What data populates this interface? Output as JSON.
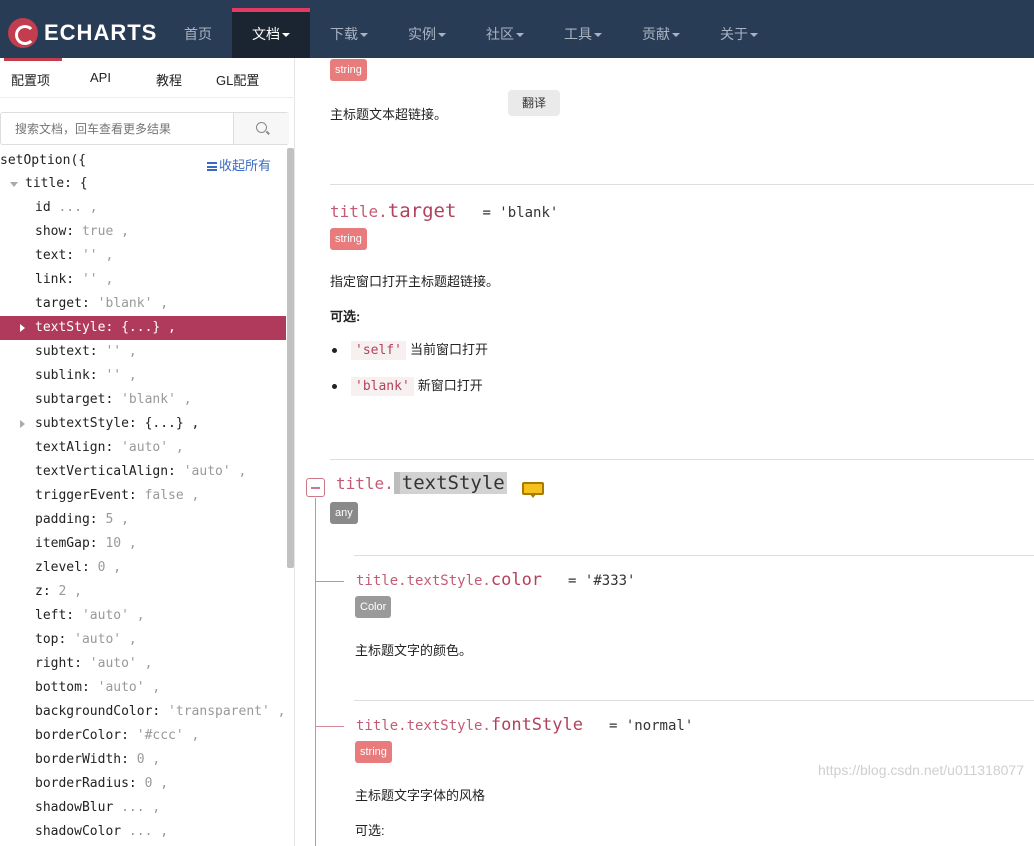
{
  "nav": {
    "logo_text": "ECHARTS",
    "items": [
      {
        "label": "首页",
        "caret": false
      },
      {
        "label": "文档",
        "caret": true
      },
      {
        "label": "下载",
        "caret": true
      },
      {
        "label": "实例",
        "caret": true
      },
      {
        "label": "社区",
        "caret": true
      },
      {
        "label": "工具",
        "caret": true
      },
      {
        "label": "贡献",
        "caret": true
      },
      {
        "label": "关于",
        "caret": true
      }
    ],
    "active_index": 1
  },
  "sidebar": {
    "tabs": [
      "配置项",
      "API",
      "教程",
      "GL配置"
    ],
    "search_placeholder": "搜索文档，回车查看更多结果",
    "tree_head": "setOption({",
    "collapse_all": "收起所有",
    "rows": [
      {
        "key": "title: {",
        "val": ""
      },
      {
        "key": "id",
        "val": " ... ,"
      },
      {
        "key": "show:",
        "val": " true ,"
      },
      {
        "key": "text:",
        "val": " '' ,"
      },
      {
        "key": "link:",
        "val": " '' ,"
      },
      {
        "key": "target:",
        "val": " 'blank' ,"
      },
      {
        "key": "textStyle: {...} ,",
        "val": ""
      },
      {
        "key": "subtext:",
        "val": " '' ,"
      },
      {
        "key": "sublink:",
        "val": " '' ,"
      },
      {
        "key": "subtarget:",
        "val": " 'blank' ,"
      },
      {
        "key": "subtextStyle: {...} ,",
        "val": ""
      },
      {
        "key": "textAlign:",
        "val": " 'auto' ,"
      },
      {
        "key": "textVerticalAlign:",
        "val": " 'auto' ,"
      },
      {
        "key": "triggerEvent:",
        "val": " false ,"
      },
      {
        "key": "padding:",
        "val": " 5 ,"
      },
      {
        "key": "itemGap:",
        "val": " 10 ,"
      },
      {
        "key": "zlevel:",
        "val": " 0 ,"
      },
      {
        "key": "z:",
        "val": " 2 ,"
      },
      {
        "key": "left:",
        "val": " 'auto' ,"
      },
      {
        "key": "top:",
        "val": " 'auto' ,"
      },
      {
        "key": "right:",
        "val": " 'auto' ,"
      },
      {
        "key": "bottom:",
        "val": " 'auto' ,"
      },
      {
        "key": "backgroundColor:",
        "val": " 'transparent' ,"
      },
      {
        "key": "borderColor:",
        "val": " '#ccc' ,"
      },
      {
        "key": "borderWidth:",
        "val": " 0 ,"
      },
      {
        "key": "borderRadius:",
        "val": " 0 ,"
      },
      {
        "key": "shadowBlur",
        "val": " ... ,"
      },
      {
        "key": "shadowColor",
        "val": " ... ,"
      }
    ]
  },
  "main": {
    "link": {
      "type": "string",
      "desc": "主标题文本超链接。",
      "translate": "翻译"
    },
    "target": {
      "prefix": "title.",
      "name": "target",
      "default": "= 'blank'",
      "type": "string",
      "desc": "指定窗口打开主标题超链接。",
      "options_label": "可选:",
      "options": [
        {
          "code": "'self'",
          "text": "当前窗口打开"
        },
        {
          "code": "'blank'",
          "text": "新窗口打开"
        }
      ]
    },
    "textStyle": {
      "prefix": "title.",
      "name": "textStyle",
      "type": "any"
    },
    "color": {
      "prefix": "title.textStyle.",
      "name": "color",
      "default": "= '#333'",
      "type": "Color",
      "desc": "主标题文字的颜色。"
    },
    "fontStyle": {
      "prefix": "title.textStyle.",
      "name": "fontStyle",
      "default": "= 'normal'",
      "type": "string",
      "desc": "主标题文字字体的风格",
      "options_label": "可选:"
    },
    "watermark": "https://blog.csdn.net/u011318077"
  },
  "colors": {
    "nav_bg": "#293c55",
    "accent": "#c23d4e",
    "selected_row": "#b03a5b",
    "type_string": "#e87b7b"
  }
}
